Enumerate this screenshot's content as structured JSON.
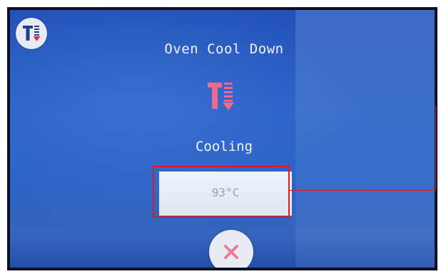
{
  "screen": {
    "title": "Oven Cool Down",
    "status": "Cooling",
    "temperature": "93°C"
  },
  "icons": {
    "corner": "oven-cool-down-icon",
    "main": "oven-cool-down-icon",
    "cancel": "close-icon"
  },
  "colors": {
    "background": "#2a5fc6",
    "icon_pink": "#f06a8a",
    "cancel_pink": "#f07a92",
    "highlight_red": "#e01919"
  }
}
